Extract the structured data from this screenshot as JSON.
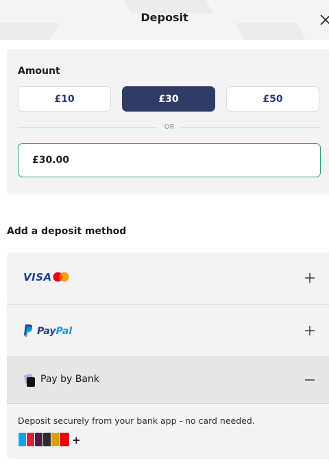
{
  "header": {
    "title": "Deposit",
    "close_icon": "close-icon",
    "background": "#f4f4f4"
  },
  "amount": {
    "label": "Amount",
    "presets": [
      {
        "label": "£10",
        "selected": false
      },
      {
        "label": "£30",
        "selected": true
      },
      {
        "label": "£50",
        "selected": false
      }
    ],
    "divider_text": "OR",
    "input_value": "£30.00",
    "accent_color": "#303c66",
    "input_border_color": "#27a07a"
  },
  "methods": {
    "title": "Add a deposit method",
    "items": [
      {
        "id": "card",
        "logo_text": "VISA",
        "extra_logo": "mastercard-logo",
        "toggle_icon": "plus-icon",
        "expanded": false
      },
      {
        "id": "paypal",
        "logo_text_part1": "Pay",
        "logo_text_part2": "Pal",
        "toggle_icon": "plus-icon",
        "expanded": false
      },
      {
        "id": "pay-by-bank",
        "label": "Pay by Bank",
        "toggle_icon": "minus-icon",
        "expanded": true,
        "description": "Deposit securely from your bank app - no card needed.",
        "bank_icons": [
          "barclays-icon",
          "natwest-icon",
          "monzo-icon",
          "starling-icon",
          "santander-icon"
        ],
        "more_label": "+"
      }
    ]
  }
}
